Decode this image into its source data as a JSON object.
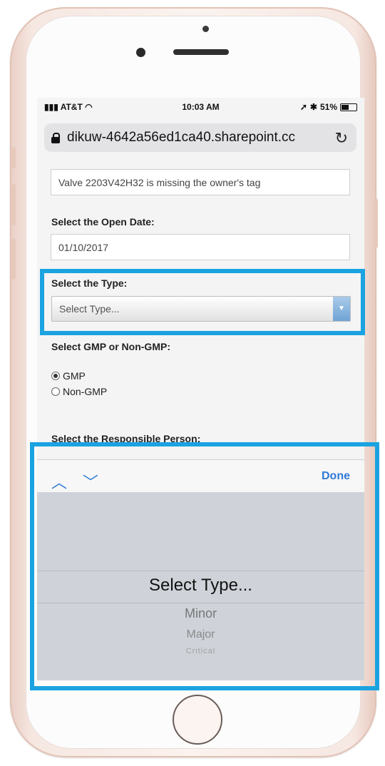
{
  "status_bar": {
    "carrier": "AT&T",
    "time": "10:03 AM",
    "battery": "51%",
    "battery_level": 0.51
  },
  "browser": {
    "url": "dikuw-4642a56ed1ca40.sharepoint.cc"
  },
  "form": {
    "description_value": "Valve 2203V42H32 is missing the owner's tag",
    "open_date_label": "Select the Open Date:",
    "open_date_value": "01/10/2017",
    "type_label": "Select the Type:",
    "type_select_value": "Select Type...",
    "gmp_label": "Select GMP or Non-GMP:",
    "gmp_options": [
      "GMP",
      "Non-GMP"
    ],
    "gmp_selected": "GMP",
    "responsible_label": "Select the Responsible Person:"
  },
  "picker": {
    "done_label": "Done",
    "selected": "Select Type...",
    "options": [
      "Minor",
      "Major",
      "Critical"
    ]
  },
  "colors": {
    "highlight": "#1aa3e0",
    "ios_blue": "#2f7ad6"
  }
}
